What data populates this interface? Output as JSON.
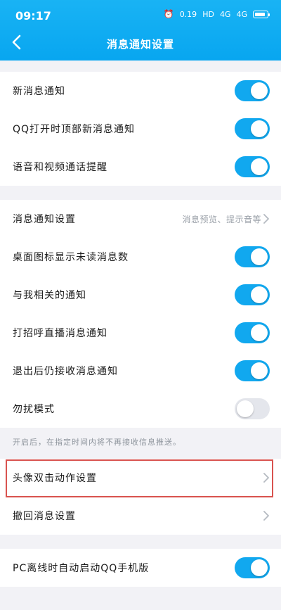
{
  "status_bar": {
    "time": "09:17",
    "speed": "0.19",
    "hd": "HD",
    "signal1": "4G",
    "signal2": "4G",
    "battery": "100"
  },
  "header": {
    "title": "消息通知设置",
    "back_icon": "back-chevron-icon"
  },
  "group1": [
    {
      "label": "新消息通知",
      "toggle": true
    },
    {
      "label": "QQ打开时顶部新消息通知",
      "toggle": true
    },
    {
      "label": "语音和视频通话提醒",
      "toggle": true
    }
  ],
  "group2": {
    "settings_row": {
      "label": "消息通知设置",
      "value": "消息预览、提示音等"
    },
    "toggles": [
      {
        "label": "桌面图标显示未读消息数",
        "toggle": true
      },
      {
        "label": "与我相关的通知",
        "toggle": true
      },
      {
        "label": "打招呼直播消息通知",
        "toggle": true
      },
      {
        "label": "退出后仍接收消息通知",
        "toggle": true
      },
      {
        "label": "勿扰模式",
        "toggle": false
      }
    ],
    "note": "开启后，在指定时间内将不再接收信息推送。"
  },
  "group3": [
    {
      "label": "头像双击动作设置"
    },
    {
      "label": "撤回消息设置"
    }
  ],
  "group4": [
    {
      "label": "PC离线时自动启动QQ手机版",
      "toggle": true
    }
  ],
  "colors": {
    "accent": "#11a8ef",
    "highlight": "#d9534f",
    "background": "#f2f2f6"
  }
}
